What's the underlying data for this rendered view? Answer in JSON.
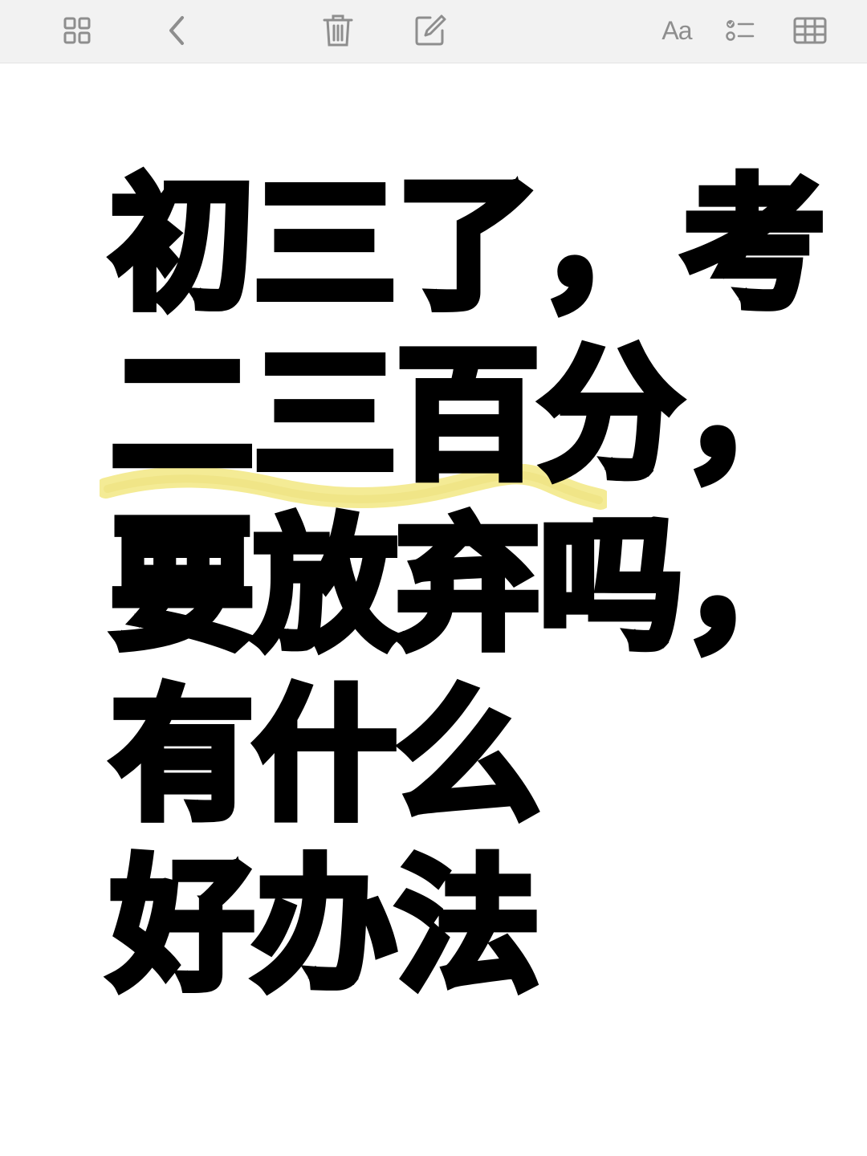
{
  "toolbar": {
    "icons": {
      "gallery": "grid-view-icon",
      "back": "chevron-left-icon",
      "delete": "trash-icon",
      "compose": "compose-icon",
      "format": "text-format-icon",
      "checklist": "checklist-icon",
      "table": "table-icon"
    },
    "format_label": "Aa"
  },
  "note": {
    "lines": [
      "初三了，考",
      "二三百分，",
      "要放弃吗，",
      "有什么",
      "好办法"
    ]
  },
  "colors": {
    "toolbar_bg": "#f2f2f2",
    "icon": "#8e8e8e",
    "text": "#000000",
    "highlighter": "#f3e98a"
  }
}
